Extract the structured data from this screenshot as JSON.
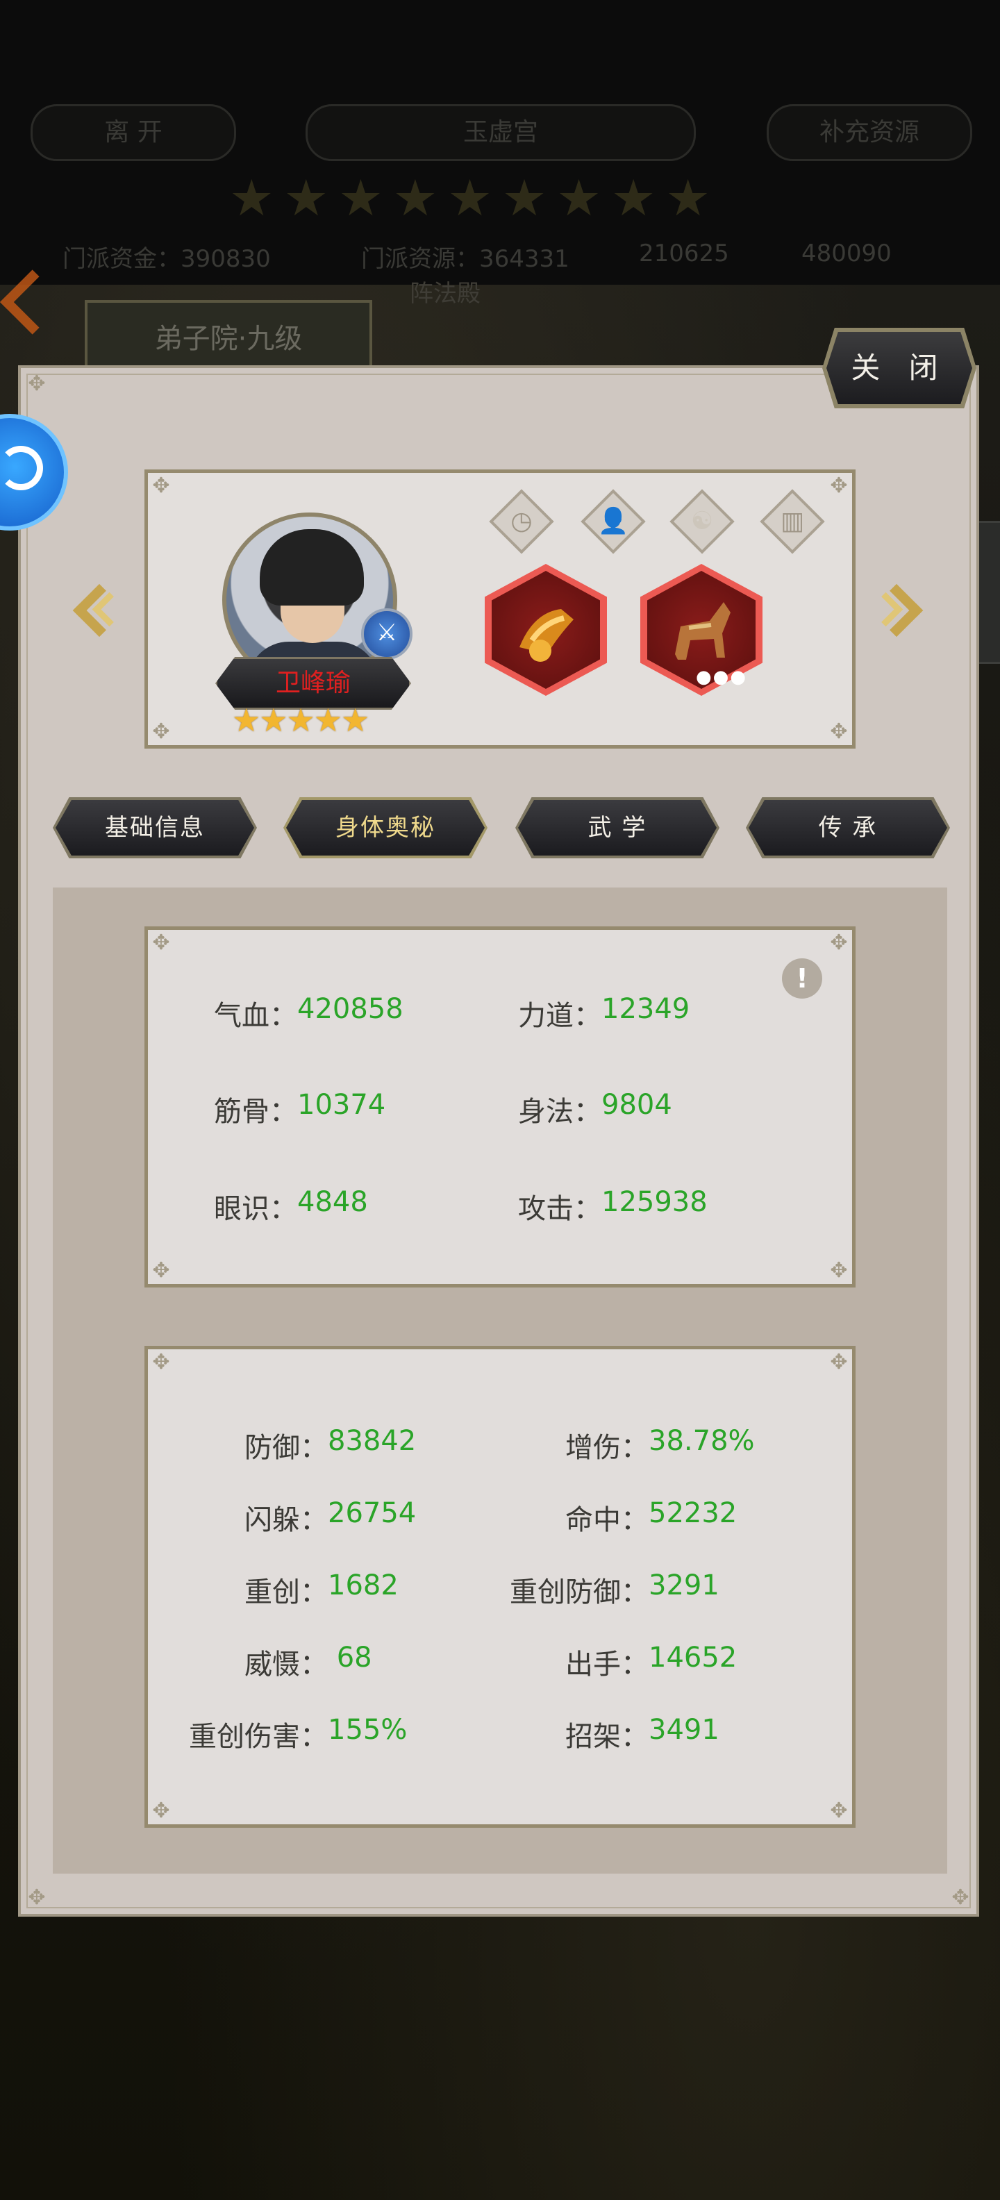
{
  "background": {
    "leave_label": "离 开",
    "sect_name": "玉虚宫",
    "supply_label": "补充资源",
    "star_count": 9,
    "resource_1": "门派资金：390830",
    "resource_2": "门派资源：364331",
    "resource_3": "210625",
    "resource_4": "480090",
    "building_label": "阵法殿",
    "department_label": "弟子院·九级"
  },
  "close_label": "关 闭",
  "hero": {
    "name": "卫峰瑜",
    "star_rating": 5,
    "status_icons": [
      "timer-icon",
      "person-icon",
      "yin-yang-icon",
      "book-icon"
    ],
    "equipment": [
      "gauntlet-item-icon",
      "war-horse-item-icon"
    ]
  },
  "tabs": [
    {
      "label": "基础信息"
    },
    {
      "label": "身体奥秘"
    },
    {
      "label": "武 学"
    },
    {
      "label": "传 承"
    }
  ],
  "active_tab": "身体奥秘",
  "primary_stats": [
    {
      "label": "气血：",
      "value": "420858"
    },
    {
      "label": "力道：",
      "value": "12349"
    },
    {
      "label": "筋骨：",
      "value": "10374"
    },
    {
      "label": "身法：",
      "value": "9804"
    },
    {
      "label": "眼识：",
      "value": "4848"
    },
    {
      "label": "攻击：",
      "value": "125938"
    }
  ],
  "secondary_stats": [
    {
      "label": "防御：",
      "value": "83842"
    },
    {
      "label": "增伤：",
      "value": "38.78%"
    },
    {
      "label": "闪躲：",
      "value": "26754"
    },
    {
      "label": "命中：",
      "value": "52232"
    },
    {
      "label": "重创：",
      "value": "1682"
    },
    {
      "label": "重创防御：",
      "value": "3291"
    },
    {
      "label": "威慑：",
      "value": " 68"
    },
    {
      "label": "出手：",
      "value": "14652"
    },
    {
      "label": "重创伤害：",
      "value": "155%"
    },
    {
      "label": "招架：",
      "value": "3491"
    }
  ],
  "colors": {
    "stat_value": "#2aa428",
    "hero_name": "#e02020",
    "active_tab": "#efd98c",
    "panel": "#cfc7c1"
  }
}
